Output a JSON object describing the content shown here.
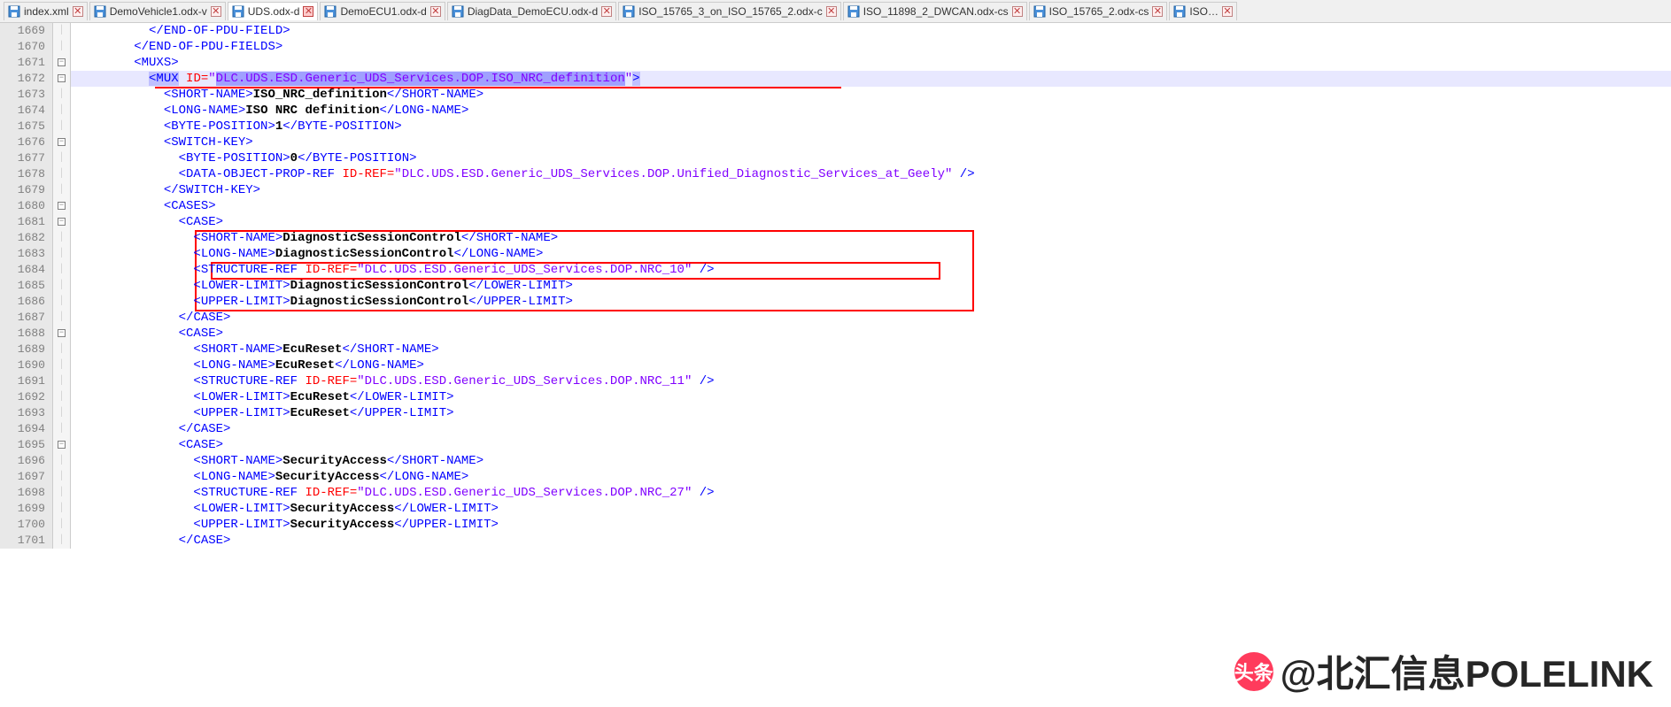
{
  "tabs": [
    {
      "label": "index.xml",
      "active": false,
      "icon": "file"
    },
    {
      "label": "DemoVehicle1.odx-v",
      "active": false,
      "icon": "file"
    },
    {
      "label": "UDS.odx-d",
      "active": true,
      "icon": "save"
    },
    {
      "label": "DemoECU1.odx-d",
      "active": false,
      "icon": "file"
    },
    {
      "label": "DiagData_DemoECU.odx-d",
      "active": false,
      "icon": "file"
    },
    {
      "label": "ISO_15765_3_on_ISO_15765_2.odx-c",
      "active": false,
      "icon": "file"
    },
    {
      "label": "ISO_11898_2_DWCAN.odx-cs",
      "active": false,
      "icon": "file"
    },
    {
      "label": "ISO_15765_2.odx-cs",
      "active": false,
      "icon": "file"
    },
    {
      "label": "ISO…",
      "active": false,
      "icon": "file"
    }
  ],
  "line_start": 1669,
  "line_end": 1701,
  "fold_markers": {
    "1671": "minus",
    "1672": "minus",
    "1676": "minus",
    "1680": "minus",
    "1681": "minus",
    "1688": "minus",
    "1695": "minus"
  },
  "highlighted_line": 1672,
  "code": {
    "mux_id": "DLC.UDS.ESD.Generic_UDS_Services.DOP.ISO_NRC_definition",
    "short_name": "ISO_NRC_definition",
    "long_name": "ISO NRC definition",
    "byte_position": "1",
    "switch_byte_position": "0",
    "switch_idref": "DLC.UDS.ESD.Generic_UDS_Services.DOP.Unified_Diagnostic_Services_at_Geely",
    "cases": [
      {
        "short_name": "DiagnosticSessionControl",
        "long_name": "DiagnosticSessionControl",
        "struct_idref": "DLC.UDS.ESD.Generic_UDS_Services.DOP.NRC_10",
        "lower_limit": "DiagnosticSessionControl",
        "upper_limit": "DiagnosticSessionControl"
      },
      {
        "short_name": "EcuReset",
        "long_name": "EcuReset",
        "struct_idref": "DLC.UDS.ESD.Generic_UDS_Services.DOP.NRC_11",
        "lower_limit": "EcuReset",
        "upper_limit": "EcuReset"
      },
      {
        "short_name": "SecurityAccess",
        "long_name": "SecurityAccess",
        "struct_idref": "DLC.UDS.ESD.Generic_UDS_Services.DOP.NRC_27",
        "lower_limit": "SecurityAccess",
        "upper_limit": "SecurityAccess"
      }
    ]
  },
  "line_texts": {
    "1669": "          </END-OF-PDU-FIELD>",
    "1670": "        </END-OF-PDU-FIELDS>",
    "1671": "        <MUXS>",
    "1672_prefix": "          ",
    "1673": "            <SHORT-NAME>ISO_NRC_definition</SHORT-NAME>",
    "1674": "            <LONG-NAME>ISO NRC definition</LONG-NAME>",
    "1675": "            <BYTE-POSITION>1</BYTE-POSITION>",
    "1676": "            <SWITCH-KEY>",
    "1677": "              <BYTE-POSITION>0</BYTE-POSITION>",
    "1678": "              <DATA-OBJECT-PROP-REF ID-REF=\"DLC.UDS.ESD.Generic_UDS_Services.DOP.Unified_Diagnostic_Services_at_Geely\" />",
    "1679": "            </SWITCH-KEY>",
    "1680": "            <CASES>",
    "1681": "              <CASE>",
    "1682": "                <SHORT-NAME>DiagnosticSessionControl</SHORT-NAME>",
    "1683": "                <LONG-NAME>DiagnosticSessionControl</LONG-NAME>",
    "1684": "                <STRUCTURE-REF ID-REF=\"DLC.UDS.ESD.Generic_UDS_Services.DOP.NRC_10\" />",
    "1685": "                <LOWER-LIMIT>DiagnosticSessionControl</LOWER-LIMIT>",
    "1686": "                <UPPER-LIMIT>DiagnosticSessionControl</UPPER-LIMIT>",
    "1687": "              </CASE>",
    "1688": "              <CASE>",
    "1689": "                <SHORT-NAME>EcuReset</SHORT-NAME>",
    "1690": "                <LONG-NAME>EcuReset</LONG-NAME>",
    "1691": "                <STRUCTURE-REF ID-REF=\"DLC.UDS.ESD.Generic_UDS_Services.DOP.NRC_11\" />",
    "1692": "                <LOWER-LIMIT>EcuReset</LOWER-LIMIT>",
    "1693": "                <UPPER-LIMIT>EcuReset</UPPER-LIMIT>",
    "1694": "              </CASE>",
    "1695": "              <CASE>",
    "1696": "                <SHORT-NAME>SecurityAccess</SHORT-NAME>",
    "1697": "                <LONG-NAME>SecurityAccess</LONG-NAME>",
    "1698": "                <STRUCTURE-REF ID-REF=\"DLC.UDS.ESD.Generic_UDS_Services.DOP.NRC_27\" />",
    "1699": "                <LOWER-LIMIT>SecurityAccess</LOWER-LIMIT>",
    "1700": "                <UPPER-LIMIT>SecurityAccess</UPPER-LIMIT>",
    "1701": "              </CASE>"
  },
  "watermark": {
    "prefix": "头条",
    "handle": "@北汇信息POLELINK"
  }
}
